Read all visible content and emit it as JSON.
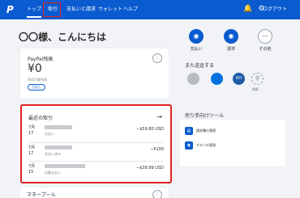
{
  "nav": {
    "logo": "P",
    "items": [
      {
        "label": "トップ"
      },
      {
        "label": "取引"
      },
      {
        "label": "支払いと請求"
      },
      {
        "label": "ウォレット"
      },
      {
        "label": "ヘルプ"
      }
    ],
    "icons": [
      "bell-icon",
      "gear-icon"
    ],
    "logout": "ログアウト"
  },
  "greeting": "〇〇様、こんにちは",
  "balance": {
    "title": "PayPal残高",
    "amount": "¥0",
    "note": "利用可能残高",
    "transfer_label": "引出し"
  },
  "transactions": {
    "title": "最近の取引",
    "rows": [
      {
        "month": "7月",
        "day": "17",
        "sub": "支払い",
        "amount": "−$59.80 USD"
      },
      {
        "month": "7月",
        "day": "17",
        "sub": "支払い済み",
        "amount": "−¥100"
      },
      {
        "month": "7月",
        "day": "15",
        "sub": "自動支払い",
        "amount": "−$39.99 USD"
      }
    ]
  },
  "money_pool": {
    "title": "マネープール"
  },
  "actions": [
    {
      "label": "支払い",
      "icon": "pay-icon",
      "color": "#0a5bd0"
    },
    {
      "label": "請求",
      "icon": "request-icon",
      "color": "#0a5bd0"
    },
    {
      "label": "その他",
      "icon": "more-icon",
      "color": "#ffffff"
    }
  ],
  "contacts": {
    "title": "また送金する",
    "items": [
      {
        "initials": "",
        "color": "#9aa3ad"
      },
      {
        "initials": "",
        "color": "#0070e0"
      },
      {
        "initials": "KH",
        "color": "#1d5ba8"
      }
    ],
    "search_label": "検索"
  },
  "tools": {
    "title": "売り手向けツール",
    "items": [
      {
        "label": "請求書の管理",
        "icon": "invoice-icon"
      },
      {
        "label": "ボタンの管理",
        "icon": "button-icon"
      }
    ]
  }
}
